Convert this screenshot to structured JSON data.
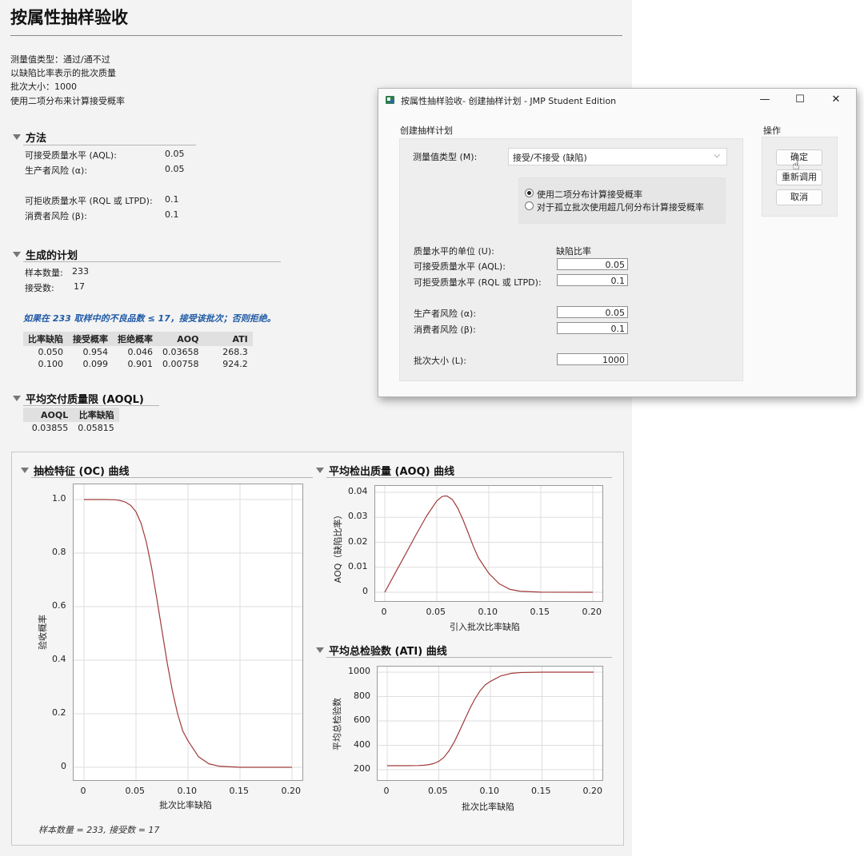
{
  "report": {
    "title": "按属性抽样验收",
    "info": [
      "测量值类型：通过/通不过",
      "以缺陷比率表示的批次质量",
      "批次大小：1000",
      "使用二项分布来计算接受概率"
    ],
    "method": {
      "heading": "方法",
      "aql_label": "可接受质量水平 (AQL):",
      "aql_value": "0.05",
      "alpha_label": "生产者风险 (α):",
      "alpha_value": "0.05",
      "rql_label": "可拒收质量水平 (RQL 或 LTPD):",
      "rql_value": "0.1",
      "beta_label": "消费者风险 (β):",
      "beta_value": "0.1"
    },
    "plan": {
      "heading": "生成的计划",
      "sample_label": "样本数量:",
      "sample_value": "233",
      "accept_label": "接受数:",
      "accept_value": "17",
      "note": "如果在 233 取样中的不良品数 ≤ 17，接受该批次；否则拒绝。",
      "table": {
        "headers": [
          "比率缺陷",
          "接受概率",
          "拒绝概率",
          "AOQ",
          "ATI"
        ],
        "rows": [
          [
            "0.050",
            "0.954",
            "0.046",
            "0.03658",
            "268.3"
          ],
          [
            "0.100",
            "0.099",
            "0.901",
            "0.00758",
            "924.2"
          ]
        ]
      }
    },
    "aoql": {
      "heading": "平均交付质量限 (AOQL)",
      "headers": [
        "AOQL",
        "比率缺陷"
      ],
      "row": [
        "0.03855",
        "0.05815"
      ]
    },
    "charts": {
      "oc_title": "抽检特征 (OC) 曲线",
      "aoq_title": "平均检出质量 (AOQ) 曲线",
      "ati_title": "平均总检验数 (ATI) 曲线",
      "caption": "样本数量 = 233, 接受数 = 17"
    }
  },
  "chart_data": [
    {
      "type": "line",
      "title": "抽检特征 (OC) 曲线",
      "xlabel": "批次比率缺陷",
      "ylabel": "验收概率",
      "xlim": [
        0,
        0.2
      ],
      "ylim": [
        0,
        1.0
      ],
      "xticks": [
        "0",
        "0.05",
        "0.10",
        "0.15",
        "0.20"
      ],
      "yticks": [
        "0",
        "0.2",
        "0.4",
        "0.6",
        "0.8",
        "1.0"
      ],
      "x": [
        0,
        0.02,
        0.03,
        0.035,
        0.04,
        0.045,
        0.05,
        0.055,
        0.06,
        0.065,
        0.07,
        0.075,
        0.08,
        0.085,
        0.09,
        0.095,
        0.1,
        0.11,
        0.12,
        0.13,
        0.15,
        0.2
      ],
      "y": [
        1.0,
        1.0,
        0.999,
        0.996,
        0.99,
        0.978,
        0.954,
        0.91,
        0.84,
        0.745,
        0.63,
        0.51,
        0.39,
        0.285,
        0.2,
        0.135,
        0.099,
        0.04,
        0.013,
        0.004,
        0.0,
        0.0
      ],
      "grid": true,
      "line_color": "#a03a3a"
    },
    {
      "type": "line",
      "title": "平均检出质量 (AOQ) 曲线",
      "xlabel": "引入批次比率缺陷",
      "ylabel": "AOQ（缺陷比率）",
      "xlim": [
        0,
        0.2
      ],
      "ylim": [
        0,
        0.04
      ],
      "xticks": [
        "0",
        "0.05",
        "0.10",
        "0.15",
        "0.20"
      ],
      "yticks": [
        "0",
        "0.01",
        "0.02",
        "0.03",
        "0.04"
      ],
      "x": [
        0,
        0.01,
        0.02,
        0.03,
        0.04,
        0.05,
        0.055,
        0.058,
        0.06,
        0.065,
        0.07,
        0.075,
        0.08,
        0.085,
        0.09,
        0.1,
        0.11,
        0.12,
        0.13,
        0.15,
        0.2
      ],
      "y": [
        0,
        0.0077,
        0.0153,
        0.023,
        0.0304,
        0.03658,
        0.0383,
        0.03855,
        0.0385,
        0.0371,
        0.0338,
        0.0292,
        0.024,
        0.0185,
        0.0138,
        0.00758,
        0.0034,
        0.0012,
        0.0004,
        5e-05,
        0
      ],
      "grid": true,
      "line_color": "#a03a3a"
    },
    {
      "type": "line",
      "title": "平均总检验数 (ATI) 曲线",
      "xlabel": "批次比率缺陷",
      "ylabel": "平均总检验数",
      "xlim": [
        0,
        0.2
      ],
      "ylim": [
        200,
        1000
      ],
      "xticks": [
        "0",
        "0.05",
        "0.10",
        "0.15",
        "0.20"
      ],
      "yticks": [
        "200",
        "400",
        "600",
        "800",
        "1000"
      ],
      "x": [
        0,
        0.02,
        0.03,
        0.035,
        0.04,
        0.045,
        0.05,
        0.055,
        0.06,
        0.065,
        0.07,
        0.075,
        0.08,
        0.085,
        0.09,
        0.095,
        0.1,
        0.11,
        0.12,
        0.13,
        0.15,
        0.2
      ],
      "y": [
        233,
        233,
        234,
        236,
        241,
        250,
        268.3,
        302,
        356,
        428,
        516,
        608,
        700,
        781,
        847,
        896,
        924.2,
        969,
        990,
        997,
        1000,
        1000
      ],
      "grid": true,
      "line_color": "#a03a3a"
    }
  ],
  "dialog": {
    "title": "按属性抽样验收- 创建抽样计划 - JMP Student Edition",
    "minimize": "—",
    "maximize": "☐",
    "close": "✕",
    "group_label": "创建抽样计划",
    "ops_label": "操作",
    "meas_label": "测量值类型 (M):",
    "meas_value": "接受/不接受 (缺陷)",
    "radio1": "使用二项分布计算接受概率",
    "radio2": "对于孤立批次使用超几何分布计算接受概率",
    "unit_label": "质量水平的单位 (U):",
    "unit_value": "缺陷比率",
    "aql_label": "可接受质量水平 (AQL):",
    "aql_value": "0.05",
    "rql_label": "可拒受质量水平 (RQL 或 LTPD):",
    "rql_value": "0.1",
    "alpha_label": "生产者风险 (α):",
    "alpha_value": "0.05",
    "beta_label": "消费者风险 (β):",
    "beta_value": "0.1",
    "lot_label": "批次大小 (L):",
    "lot_value": "1000",
    "ok": "确定",
    "recall": "重新调用",
    "cancel": "取消"
  }
}
